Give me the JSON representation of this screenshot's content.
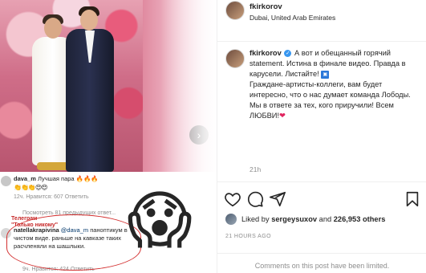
{
  "colors": {
    "verified": "#3897f0",
    "link": "#00376b",
    "muted": "#8e8e8e",
    "like_heart": "#e0245e",
    "telegram_red": "#c62828"
  },
  "post_header": {
    "username": "fkirkorov",
    "location": "Dubai, United Arab Emirates"
  },
  "caption": {
    "username": "fkirkorov",
    "line1": "А вот и обещанный горячий statement. Истина в финале видео. Правда в карусели. Листайте!",
    "line2": "Граждане-артисты-коллеги, вам будет интересно, что о нас думает команда Лободы.",
    "line3": "Мы в ответе за тех, кого приручили! Всем ЛЮБВИ!",
    "time": "21h"
  },
  "actions": {
    "like_icon": "heart-outline-icon",
    "comment_icon": "speech-bubble-icon",
    "share_icon": "paper-plane-icon",
    "save_icon": "bookmark-icon"
  },
  "likes": {
    "prefix": "Liked by ",
    "user": "sergeysuxov",
    "middle": " and ",
    "count": "226,953 others"
  },
  "post_time": "21 HOURS AGO",
  "comments_limited": "Comments on this post have been limited.",
  "embedded": {
    "comment1": {
      "user": "dava_m",
      "text": "Лучшая пара 🔥🔥🔥",
      "emoji": "👏👏👏😍😍",
      "age": "12ч.",
      "likes": "Нравится: 607",
      "reply": "Ответить"
    },
    "view_replies": "Посмотреть 81 предыдущих ответ...",
    "telegram_badge_line1": "Телеграм",
    "telegram_badge_line2": "\"Только никому\"",
    "comment2": {
      "user": "natellakrapivina",
      "mention": "@dava_m",
      "text": " паноптикум в чистом виде. раньше на кавказе таких расчленяли на шашлыки.",
      "age": "9ч.",
      "likes": "Нравится: 424",
      "reply": "Ответить"
    },
    "scream_emoji": "😱"
  }
}
